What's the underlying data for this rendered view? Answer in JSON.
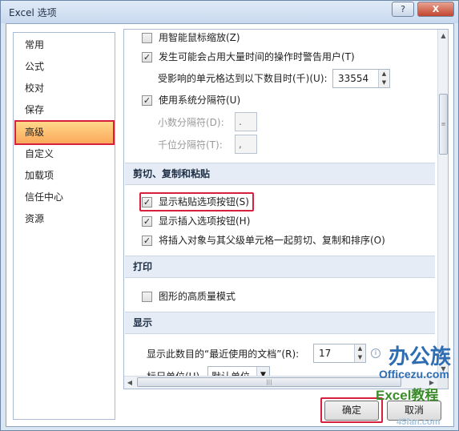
{
  "window": {
    "title": "Excel 选项",
    "help_label": "?",
    "close_label": "X"
  },
  "nav": {
    "items": [
      "常用",
      "公式",
      "校对",
      "保存",
      "高级",
      "自定义",
      "加载项",
      "信任中心",
      "资源"
    ],
    "selected_index": 4
  },
  "options": {
    "smart_zoom": {
      "label": "用智能鼠标缩放(Z)",
      "checked": false
    },
    "long_op_warn": {
      "label": "发生可能会占用大量时间的操作时警告用户(T)",
      "checked": true
    },
    "cells_affected_label": "受影响的单元格达到以下数目时(千)(U):",
    "cells_affected_value": "33554",
    "system_separators": {
      "label": "使用系统分隔符(U)",
      "checked": true
    },
    "decimal_sep_label": "小数分隔符(D):",
    "decimal_sep_value": ".",
    "thousands_sep_label": "千位分隔符(T):",
    "thousands_sep_value": ","
  },
  "sections": {
    "cut_copy_paste": "剪切、复制和粘贴",
    "print": "打印",
    "display": "显示"
  },
  "cut_copy_paste": {
    "show_paste_options": {
      "label": "显示粘贴选项按钮(S)",
      "checked": true
    },
    "show_insert_options": {
      "label": "显示插入选项按钮(H)",
      "checked": true
    },
    "cut_copy_sort_objects": {
      "label": "将插入对象与其父级单元格一起剪切、复制和排序(O)",
      "checked": true
    }
  },
  "print": {
    "high_quality_graphics": {
      "label": "图形的高质量模式",
      "checked": false
    }
  },
  "display": {
    "recent_docs_label": "显示此数目的“最近使用的文档”(R):",
    "recent_docs_value": "17",
    "ruler_units_label": "标尺单位(U)",
    "ruler_units_value": "默认单位"
  },
  "buttons": {
    "ok": "确定",
    "cancel": "取消"
  },
  "watermark": {
    "brand_cn": "办公族",
    "brand_url": "Officezu.com",
    "excel_tutorial": "Excel教程",
    "faded_site": "45fan.com"
  },
  "colors": {
    "highlight_red": "#d6203d",
    "selected_nav_bg": "#fba85b",
    "section_bg": "#e5ecf5"
  }
}
